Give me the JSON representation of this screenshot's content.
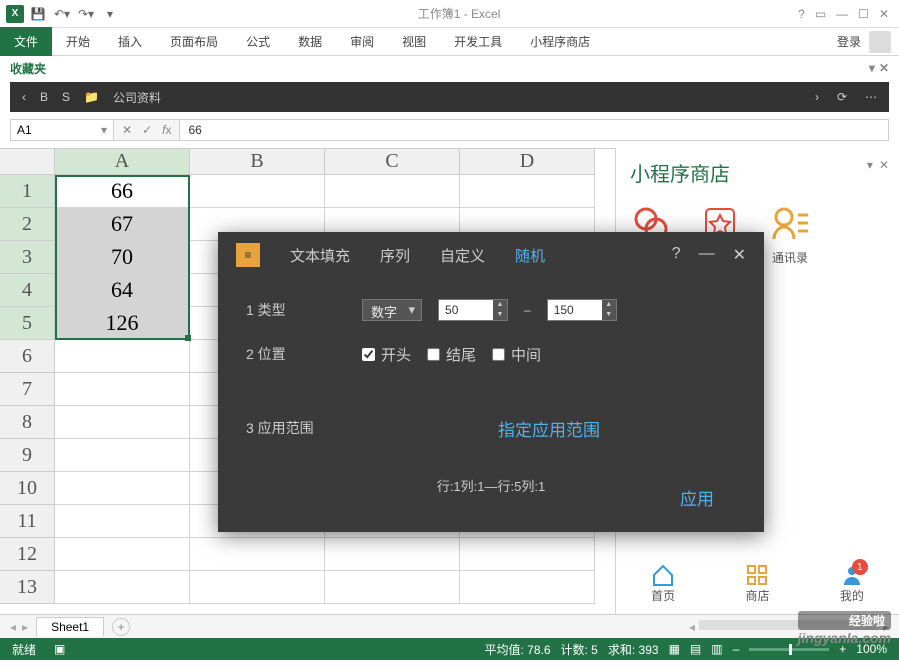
{
  "title": "工作簿1 - Excel",
  "qat": {
    "save": "💾"
  },
  "ribbon": {
    "file": "文件",
    "home": "开始",
    "insert": "插入",
    "layout": "页面布局",
    "formula": "公式",
    "data": "数据",
    "review": "审阅",
    "view": "视图",
    "dev": "开发工具",
    "store": "小程序商店",
    "login": "登录"
  },
  "favbar": {
    "label": "收藏夹"
  },
  "pathbar": {
    "b": "B",
    "s": "S",
    "folder": "公司资料"
  },
  "namebox": "A1",
  "formula": "66",
  "cols": [
    "A",
    "B",
    "C",
    "D"
  ],
  "rows": [
    "1",
    "2",
    "3",
    "4",
    "5",
    "6",
    "7",
    "8",
    "9",
    "10",
    "11",
    "12",
    "13"
  ],
  "cells": {
    "A1": "66",
    "A2": "67",
    "A3": "70",
    "A4": "64",
    "A5": "126"
  },
  "pane": {
    "title": "小程序商店",
    "contacts": "通讯录",
    "home": "首页",
    "shop": "商店",
    "mine": "我的",
    "badge": "1"
  },
  "dialog": {
    "tab_fill": "文本填充",
    "tab_seq": "序列",
    "tab_custom": "自定义",
    "tab_random": "随机",
    "row1_label": "1 类型",
    "type_val": "数字",
    "min": "50",
    "max": "150",
    "row2_label": "2 位置",
    "pos_start": "开头",
    "pos_end": "结尾",
    "pos_mid": "中间",
    "row3_label": "3 应用范围",
    "range_link": "指定应用范围",
    "range_text": "行:1列:1—行:5列:1",
    "apply": "应用"
  },
  "sheettab": {
    "name": "Sheet1"
  },
  "status": {
    "ready": "就绪",
    "avg": "平均值: 78.6",
    "count": "计数: 5",
    "sum": "求和: 393",
    "zoom": "100%"
  },
  "watermark": {
    "brand": "经验啦",
    "url": "jingyanla.com"
  }
}
